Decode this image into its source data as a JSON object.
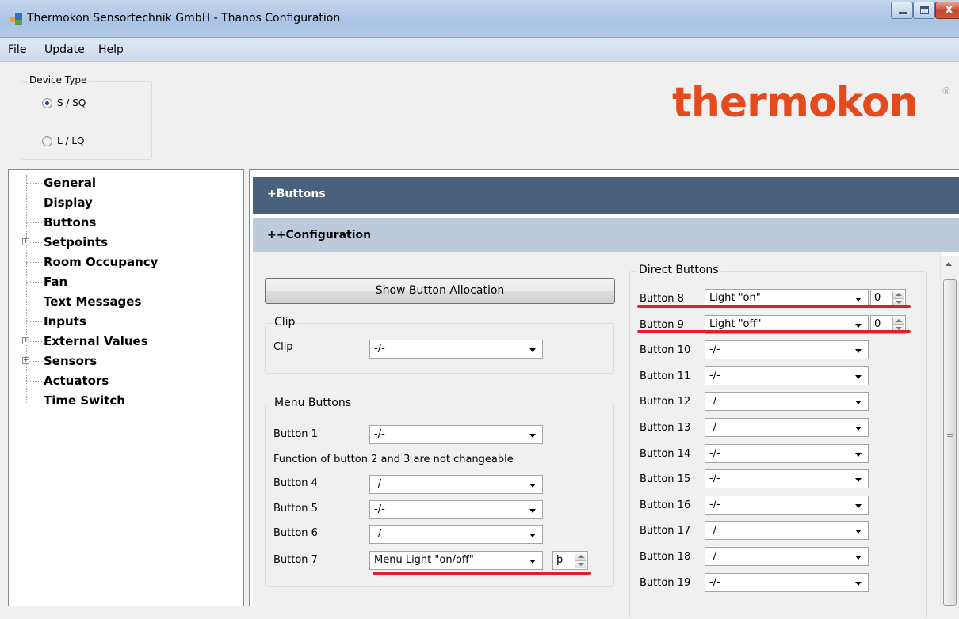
{
  "window": {
    "title": "Thermokon Sensortechnik GmbH - Thanos Configuration"
  },
  "menu": [
    "File",
    "Update",
    "Help"
  ],
  "device_type": {
    "title": "Device Type",
    "options": [
      {
        "label": "S / SQ",
        "checked": true
      },
      {
        "label": "L / LQ",
        "checked": false
      }
    ]
  },
  "logo": {
    "text": "thermokon",
    "reg": "®"
  },
  "tree": [
    {
      "label": "General",
      "expandable": false
    },
    {
      "label": "Display",
      "expandable": false
    },
    {
      "label": "Buttons",
      "expandable": false
    },
    {
      "label": "Setpoints",
      "expandable": true
    },
    {
      "label": "Room Occupancy",
      "expandable": false
    },
    {
      "label": "Fan",
      "expandable": false
    },
    {
      "label": "Text Messages",
      "expandable": false
    },
    {
      "label": "Inputs",
      "expandable": false
    },
    {
      "label": "External Values",
      "expandable": true
    },
    {
      "label": "Sensors",
      "expandable": true
    },
    {
      "label": "Actuators",
      "expandable": false
    },
    {
      "label": "Time Switch",
      "expandable": false
    }
  ],
  "headers": {
    "buttons": "+Buttons",
    "configuration": "++Configuration"
  },
  "show_allocation_label": "Show Button Allocation",
  "clip": {
    "title": "Clip",
    "label": "Clip",
    "value": "-/-"
  },
  "menu_buttons": {
    "title": "Menu Buttons",
    "button1": {
      "label": "Button 1",
      "value": "-/-"
    },
    "note": "Function of button 2 and 3 are not changeable",
    "rows": [
      {
        "label": "Button 4",
        "value": "-/-"
      },
      {
        "label": "Button 5",
        "value": "-/-"
      },
      {
        "label": "Button 6",
        "value": "-/-"
      }
    ],
    "button7": {
      "label": "Button 7",
      "value": "Menu Light \"on/off\"",
      "spin": "ϸ"
    }
  },
  "direct_buttons": {
    "title": "Direct Buttons",
    "rows": [
      {
        "label": "Button 8",
        "value": "Light \"on\"",
        "spin": "0"
      },
      {
        "label": "Button 9",
        "value": "Light \"off\"",
        "spin": "0"
      },
      {
        "label": "Button 10",
        "value": "-/-"
      },
      {
        "label": "Button 11",
        "value": "-/-"
      },
      {
        "label": "Button 12",
        "value": "-/-"
      },
      {
        "label": "Button 13",
        "value": "-/-"
      },
      {
        "label": "Button 14",
        "value": "-/-"
      },
      {
        "label": "Button 15",
        "value": "-/-"
      },
      {
        "label": "Button 16",
        "value": "-/-"
      },
      {
        "label": "Button 17",
        "value": "-/-"
      },
      {
        "label": "Button 18",
        "value": "-/-"
      },
      {
        "label": "Button 19",
        "value": "-/-"
      }
    ]
  },
  "colors": {
    "title_gradient": "#a9c3e4",
    "header_dark": "#4a617e",
    "header_light": "#bccadb",
    "logo": "#e34a1e",
    "highlight": "#e41d2b"
  },
  "icons": [
    "app-icon",
    "minimize-icon",
    "maximize-icon",
    "close-icon",
    "expand-plus-icon",
    "chevron-down-icon",
    "spin-up-icon",
    "spin-down-icon",
    "scroll-up-icon"
  ]
}
